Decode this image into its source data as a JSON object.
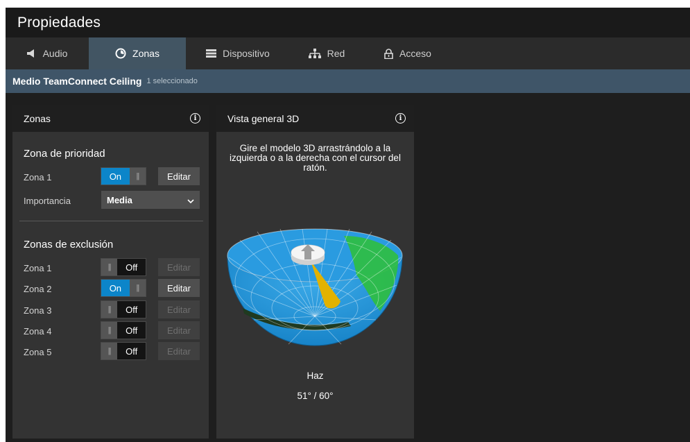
{
  "app": {
    "title": "Propiedades"
  },
  "tabs": [
    {
      "label": "Audio",
      "icon": "speaker-icon"
    },
    {
      "label": "Zonas",
      "icon": "zones-icon"
    },
    {
      "label": "Dispositivo",
      "icon": "device-list-icon"
    },
    {
      "label": "Red",
      "icon": "network-icon"
    },
    {
      "label": "Acceso",
      "icon": "lock-icon"
    }
  ],
  "active_tab": "Zonas",
  "device": {
    "name": "Medio TeamConnect Ceiling",
    "selected": "1 seleccionado"
  },
  "zones_panel": {
    "title": "Zonas",
    "priority": {
      "title": "Zona de prioridad",
      "zone_label": "Zona 1",
      "toggle": "On",
      "edit": "Editar",
      "importance_label": "Importancia",
      "importance_value": "Media"
    },
    "exclusion": {
      "title": "Zonas de exclusión",
      "zones": [
        {
          "label": "Zona 1",
          "state": "Off",
          "edit": "Editar",
          "enabled": false
        },
        {
          "label": "Zona 2",
          "state": "On",
          "edit": "Editar",
          "enabled": true
        },
        {
          "label": "Zona 3",
          "state": "Off",
          "edit": "Editar",
          "enabled": false
        },
        {
          "label": "Zona 4",
          "state": "Off",
          "edit": "Editar",
          "enabled": false
        },
        {
          "label": "Zona 5",
          "state": "Off",
          "edit": "Editar",
          "enabled": false
        }
      ]
    }
  },
  "view_panel": {
    "title": "Vista general 3D",
    "instructions": "Gire el modelo 3D arrastrándolo a la izquierda o a la derecha con el cursor del ratón.",
    "beam_label": "Haz",
    "beam_value": "51° / 60°"
  },
  "colors": {
    "accent": "#0c85c9",
    "dome": "#1b8fd6",
    "priority_zone": "#2fbf3f",
    "exclusion_zone": "#1f3a20",
    "beam": "#e2b200"
  }
}
